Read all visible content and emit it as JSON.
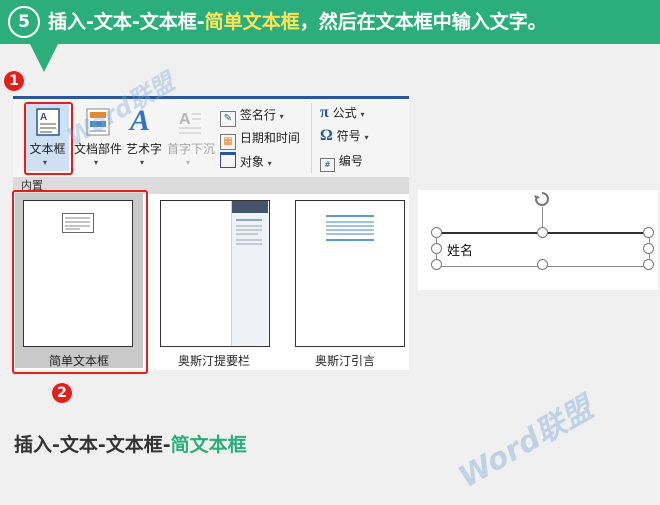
{
  "banner": {
    "step": "5",
    "text_before": "插入-文本-文本框-",
    "text_highlight": "简单文本框",
    "text_after": "，然后在文本框中输入文字。"
  },
  "markers": {
    "one": "1",
    "two": "2"
  },
  "ribbon": {
    "text_box": "文本框",
    "quick_parts": "文档部件",
    "wordart": "艺术字",
    "drop_cap": "首字下沉",
    "signature_line": "签名行",
    "date_time": "日期和时间",
    "object": "对象",
    "equation": "公式",
    "symbol": "符号",
    "number": "编号"
  },
  "gallery": {
    "section": "内置",
    "items": [
      "简单文本框",
      "奥斯汀提要栏",
      "奥斯汀引言"
    ]
  },
  "preview": {
    "text": "姓名"
  },
  "subtitle": {
    "text_before": "插入-文本-文本框-",
    "text_highlight": "简文本框"
  },
  "watermark": "Word联盟",
  "colors": {
    "green": "#2bae7b",
    "red": "#e1201b",
    "yellow": "#ffe25a",
    "ribbon_blue": "#2b579a"
  }
}
